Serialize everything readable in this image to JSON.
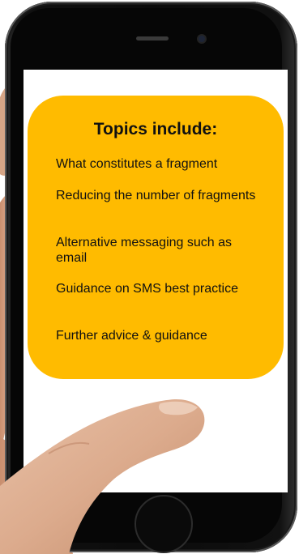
{
  "card": {
    "background": "#FFBB00",
    "title": "Topics include:",
    "topics": [
      "What constitutes a fragment",
      "Reducing the number of fragments",
      "Alternative messaging such as email",
      "Guidance on SMS best practice",
      "Further advice & guidance"
    ]
  },
  "icons": {
    "phone": "smartphone",
    "hand": "hand",
    "home_button": "home-button"
  }
}
